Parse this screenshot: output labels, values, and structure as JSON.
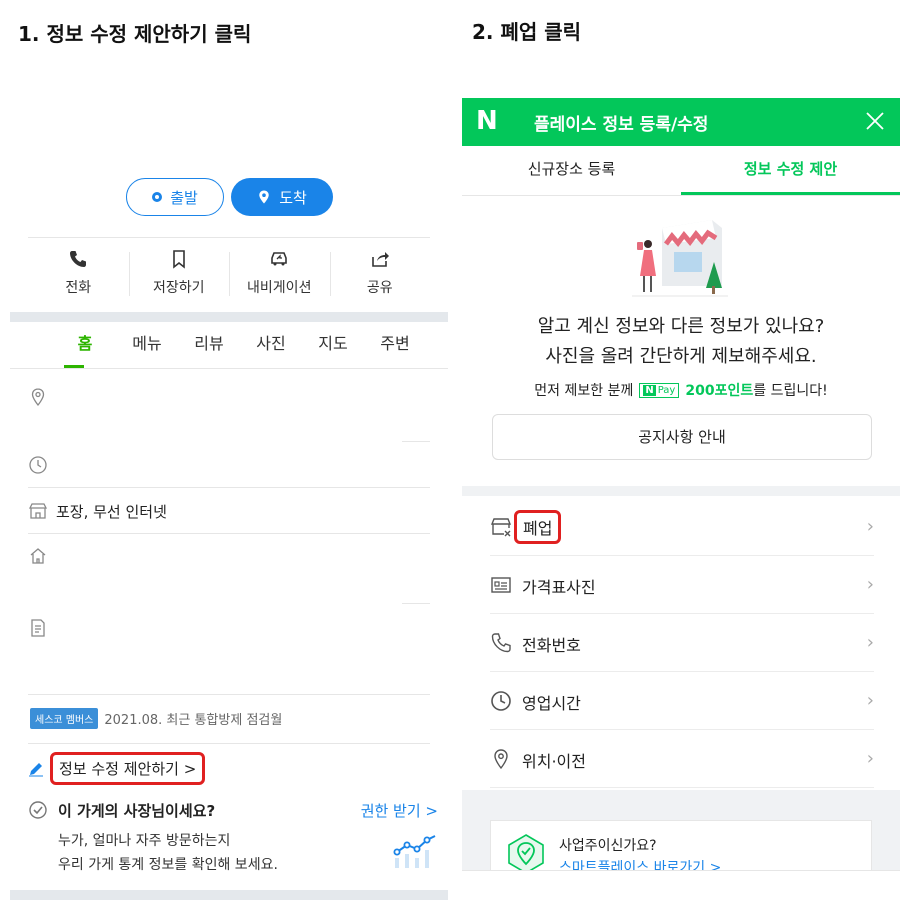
{
  "steps": {
    "step1": "1. 정보 수정 제안하기  클릭",
    "step2": "2. 폐업 클릭"
  },
  "left": {
    "route": {
      "depart": "출발",
      "arrive": "도착"
    },
    "actions": [
      {
        "label": "전화",
        "icon": "phone-icon"
      },
      {
        "label": "저장하기",
        "icon": "bookmark-icon"
      },
      {
        "label": "내비게이션",
        "icon": "car-icon"
      },
      {
        "label": "공유",
        "icon": "share-icon"
      }
    ],
    "tabs": [
      "홈",
      "메뉴",
      "리뷰",
      "사진",
      "지도",
      "주변"
    ],
    "info": {
      "amenities": "포장, 무선 인터넷"
    },
    "badge": "세스코 멤버스",
    "badge_text": "2021.08. 최근 통합방제 점검월",
    "suggest_link": "정보 수정 제안하기 >",
    "owner": {
      "title": "이 가게의 사장님이세요?",
      "link": "권한 받기 >",
      "desc1": "누가, 얼마나 자주 방문하는지",
      "desc2": "우리 가게 통계 정보를 확인해 보세요."
    }
  },
  "right": {
    "logo": "N",
    "title": "플레이스 정보 등록/수정",
    "tabs": [
      "신규장소 등록",
      "정보 수정 제안"
    ],
    "message1": "알고 계신 정보와 다른 정보가 있나요?",
    "message2": "사진을 올려 간단하게 제보해주세요.",
    "reward_prefix": "먼저 제보한 분께",
    "npay_n": "N",
    "npay_label": "Pay",
    "reward_points": "200포인트",
    "reward_suffix": "를 드립니다!",
    "notice_button": "공지사항 안내",
    "items": [
      {
        "label": "폐업",
        "icon": "closed-store-icon"
      },
      {
        "label": "가격표사진",
        "icon": "price-list-icon"
      },
      {
        "label": "전화번호",
        "icon": "phone-icon"
      },
      {
        "label": "영업시간",
        "icon": "clock-icon"
      },
      {
        "label": "위치·이전",
        "icon": "location-pin-icon"
      }
    ],
    "biz_question": "사업주이신가요?",
    "biz_link": "스마트플레이스 바로가기 >"
  },
  "colors": {
    "naver_green": "#03c75a",
    "blue": "#1a84e8",
    "highlight_red": "#e02020"
  }
}
